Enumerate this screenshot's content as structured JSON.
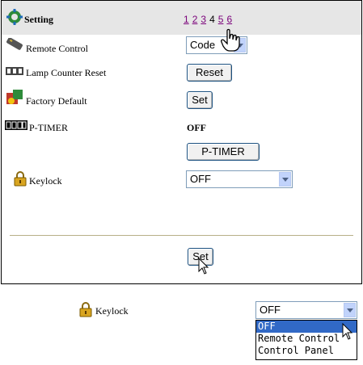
{
  "header": {
    "title": "Setting",
    "pages": [
      {
        "label": "1",
        "current": false
      },
      {
        "label": "2",
        "current": false
      },
      {
        "label": "3",
        "current": false
      },
      {
        "label": "4",
        "current": true
      },
      {
        "label": "5",
        "current": false
      },
      {
        "label": "6",
        "current": false
      }
    ]
  },
  "rows": {
    "remote": {
      "label": "Remote Control",
      "control_value": "Code"
    },
    "lamp": {
      "label": "Lamp Counter Reset",
      "button": "Reset"
    },
    "factory": {
      "label": "Factory Default",
      "button": "Set"
    },
    "ptimer": {
      "label": "P-TIMER",
      "value": "OFF",
      "button": "P-TIMER"
    },
    "keylock": {
      "label": "Keylock",
      "value": "OFF"
    }
  },
  "footer": {
    "set_button": "Set"
  },
  "expanded": {
    "label": "Keylock",
    "value": "OFF",
    "options": [
      "OFF",
      "Remote Control",
      "Control Panel"
    ],
    "selected_index": 0
  },
  "colors": {
    "header_bg": "#e6e6e6",
    "link": "#7a007a",
    "highlight": "#3169c6",
    "divider": "#b7b087"
  }
}
